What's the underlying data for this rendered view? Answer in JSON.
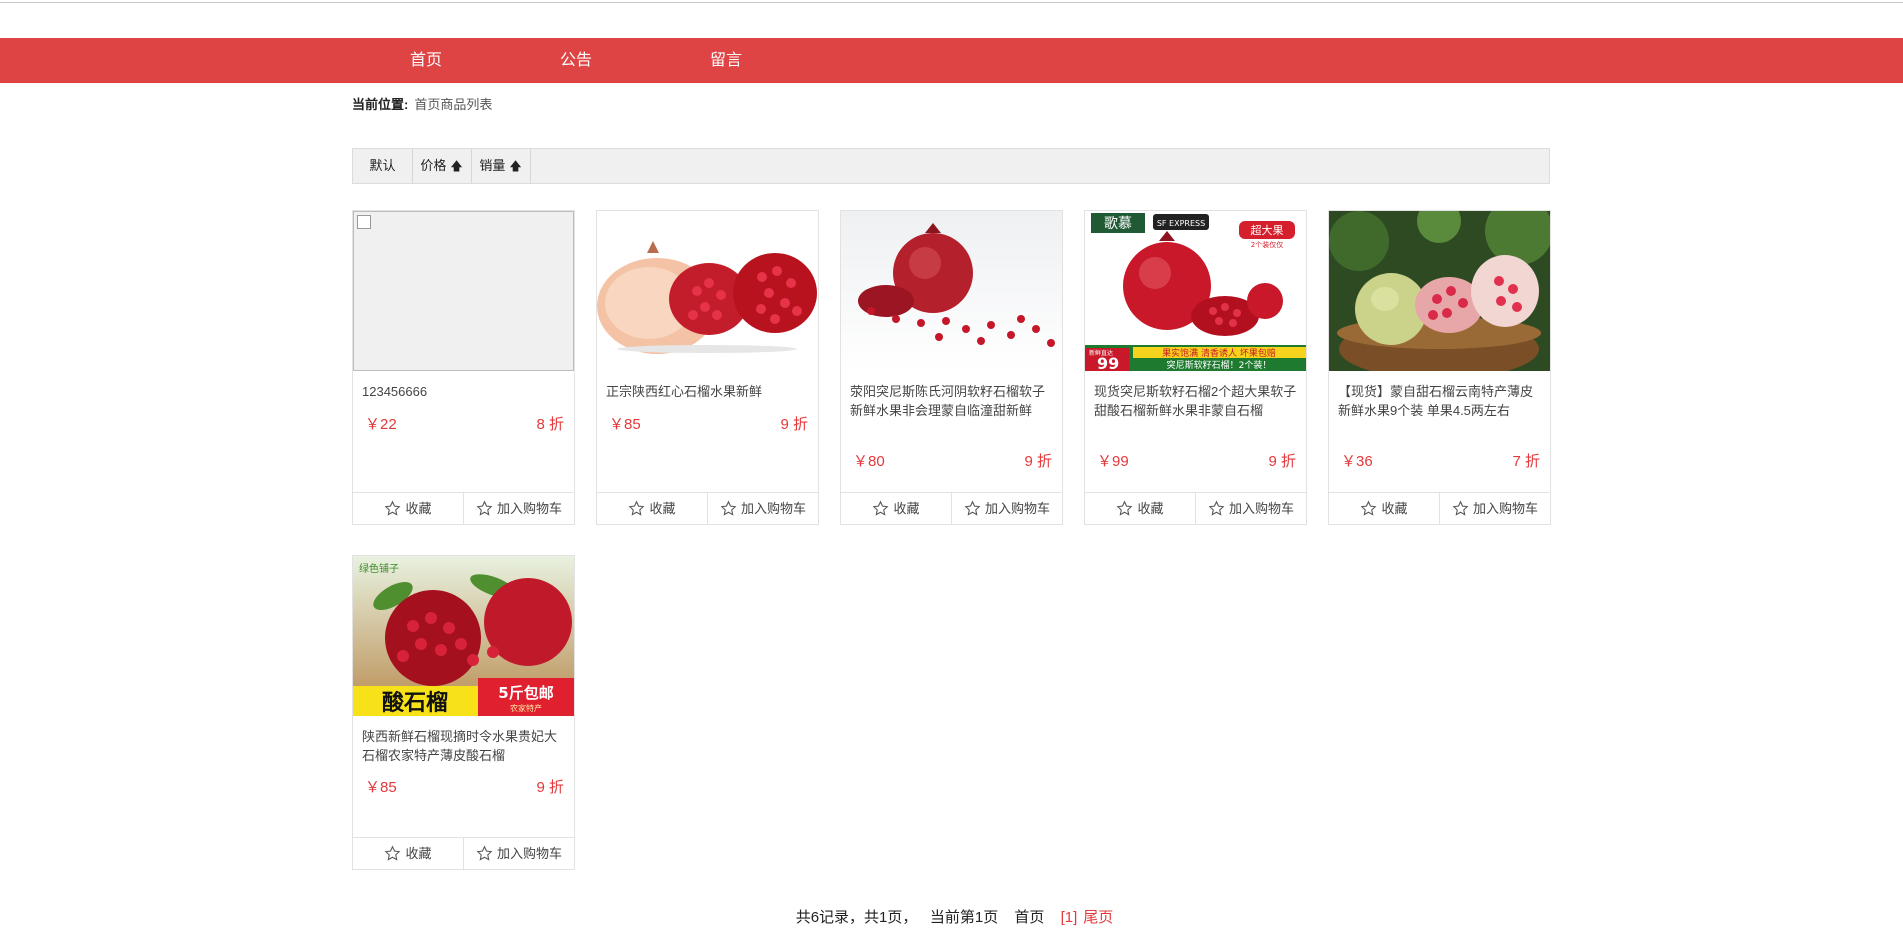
{
  "nav": {
    "items": [
      "首页",
      "公告",
      "留言"
    ]
  },
  "breadcrumb": {
    "label": "当前位置:",
    "value": "首页商品列表"
  },
  "sort": {
    "default": "默认",
    "price": "价格",
    "sales": "销量"
  },
  "actions": {
    "favorite": "收藏",
    "cart": "加入购物车"
  },
  "products": [
    {
      "name": "123456666",
      "price": "￥22",
      "discount": "8 折"
    },
    {
      "name": "正宗陕西红心石榴水果新鲜",
      "price": "￥85",
      "discount": "9 折"
    },
    {
      "name": "荥阳突尼斯陈氏河阴软籽石榴软子新鲜水果非会理蒙自临潼甜新鲜",
      "price": "￥80",
      "discount": "9 折"
    },
    {
      "name": "现货突尼斯软籽石榴2个超大果软子甜酸石榴新鲜水果非蒙自石榴",
      "price": "￥99",
      "discount": "9 折"
    },
    {
      "name": "【现货】蒙自甜石榴云南特产薄皮 新鲜水果9个装 单果4.5两左右",
      "price": "￥36",
      "discount": "7 折"
    },
    {
      "name": "陕西新鲜石榴现摘时令水果贵妃大石榴农家特产薄皮酸石榴",
      "price": "￥85",
      "discount": "9 折"
    }
  ],
  "banners": {
    "p4_brand": "歌慕",
    "p4_express": "SF EXPRESS",
    "p4_badge": "超大果",
    "p4_badge_sub": "2个装仅仅",
    "p4_price_tag": "新鲜直达",
    "p4_price": "99",
    "p4_slogan": "果实饱满 清香诱人 坏果包赔",
    "p4_bottom": "突尼斯软籽石榴！2个装！",
    "p6_logo": "绿色铺子",
    "p6_title": "酸石榴",
    "p6_ship": "5斤包邮",
    "p6_sub": "农家特产"
  },
  "pager": {
    "summary": "共6记录，共1页，   当前第1页",
    "first": "首页",
    "current": "[1]",
    "last": "尾页"
  },
  "colors": {
    "brand": "#df4445",
    "price": "#e4393c"
  }
}
